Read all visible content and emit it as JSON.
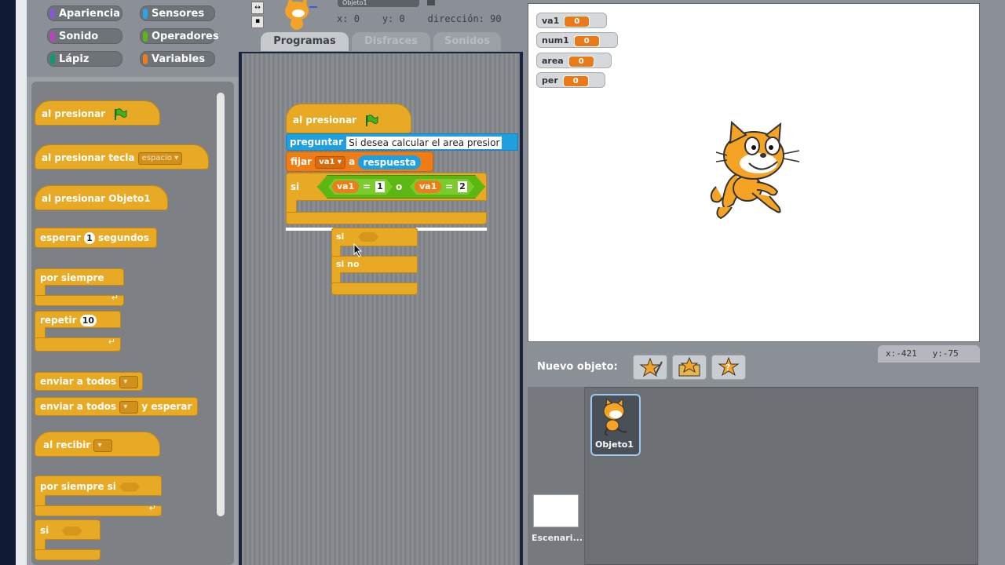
{
  "categories": [
    {
      "label": "Apariencia",
      "color": "#8a55d7"
    },
    {
      "label": "Sensores",
      "color": "#2ca5e2"
    },
    {
      "label": "Sonido",
      "color": "#bb42c3"
    },
    {
      "label": "Operadores",
      "color": "#5cb712"
    },
    {
      "label": "Lápiz",
      "color": "#0e9a6c"
    },
    {
      "label": "Variables",
      "color": "#ee7d16"
    }
  ],
  "palette": {
    "when_flag": "al presionar",
    "when_key": "al presionar tecla",
    "when_key_value": "espacio",
    "when_clicked": "al presionar  Objeto1",
    "wait": "esperar",
    "wait_value": "1",
    "wait_unit": "segundos",
    "forever": "por siempre",
    "repeat": "repetir",
    "repeat_value": "10",
    "broadcast": "enviar a todos",
    "broadcast_wait": "enviar a todos",
    "broadcast_wait_suffix": "y esperar",
    "when_receive": "al recibir",
    "forever_if": "por siempre si",
    "if": "si"
  },
  "sprite": {
    "name": "Objeto1",
    "x_label": "x:",
    "x_value": "0",
    "y_label": "y:",
    "y_value": "0",
    "direction_label": "dirección:",
    "direction_value": "90"
  },
  "tabs": [
    "Programas",
    "Disfraces",
    "Sonidos"
  ],
  "script": {
    "hat": "al presionar",
    "ask": "preguntar",
    "ask_text": "Si desea calcular el area presior",
    "set": "fijar",
    "set_var": "va1",
    "set_to": "a",
    "answer": "respuesta",
    "if": "si",
    "cond_var1": "va1",
    "cond_eq1": "=",
    "cond_val1": "1",
    "cond_or": "o",
    "cond_var2": "va1",
    "cond_eq2": "=",
    "cond_val2": "2",
    "drag_if": "si",
    "drag_else": "si no"
  },
  "monitors": [
    {
      "name": "va1",
      "value": "0"
    },
    {
      "name": "num1",
      "value": "0"
    },
    {
      "name": "area",
      "value": "0"
    },
    {
      "name": "per",
      "value": "0"
    }
  ],
  "new_object_label": "Nuevo objeto:",
  "mouse": {
    "x_label": "x:",
    "x_value": "-421",
    "y_label": "y:",
    "y_value": "-75"
  },
  "sprite_list": {
    "sprite_name": "Objeto1",
    "stage_name": "Escenari..."
  }
}
